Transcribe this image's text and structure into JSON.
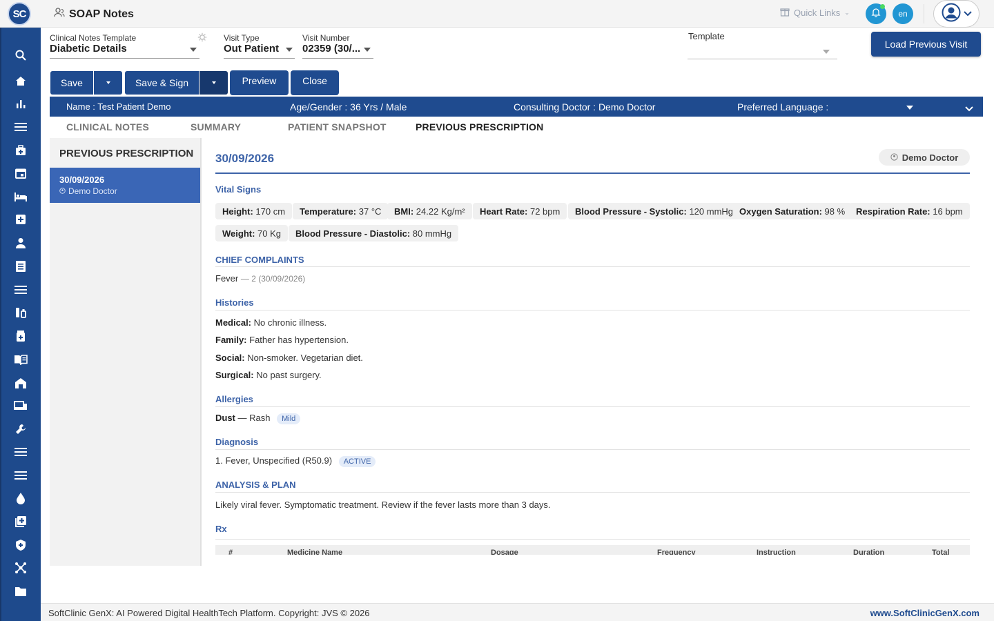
{
  "header": {
    "logo_text": "SC",
    "title": "SOAP Notes",
    "quick_links": "Quick Links",
    "language": "en"
  },
  "form": {
    "clinical_template_label": "Clinical Notes Template",
    "clinical_template_value": "Diabetic Details",
    "visit_type_label": "Visit Type",
    "visit_type_value": "Out Patient",
    "visit_number_label": "Visit Number",
    "visit_number_value": "02359 (30/...",
    "template_label": "Template",
    "template_value": "",
    "load_previous_label": "Load Previous Visit"
  },
  "toolbar": {
    "save": "Save",
    "save_sign": "Save & Sign",
    "preview": "Preview",
    "close": "Close"
  },
  "patient": {
    "name": "Name :  Test Patient Demo",
    "age_gender": "Age/Gender :  36 Yrs / Male",
    "doctor": "Consulting Doctor :  Demo Doctor",
    "language": "Preferred Language :"
  },
  "tabs": [
    "CLINICAL NOTES",
    "SUMMARY",
    "PATIENT SNAPSHOT",
    "PREVIOUS PRESCRIPTION"
  ],
  "left_panel": {
    "heading": "PREVIOUS PRESCRIPTION",
    "items": [
      {
        "date": "30/09/2026",
        "doctor": "Demo Doctor"
      }
    ]
  },
  "detail": {
    "date": "30/09/2026",
    "doctor": "Demo Doctor",
    "vitals_title": "Vital Signs",
    "vitals": [
      {
        "label": "Height:",
        "value": "170 cm"
      },
      {
        "label": "Temperature:",
        "value": "37 °C"
      },
      {
        "label": "BMI:",
        "value": "24.22 Kg/m²"
      },
      {
        "label": "Heart Rate:",
        "value": "72 bpm"
      },
      {
        "label": "Blood Pressure - Systolic:",
        "value": "120 mmHg"
      },
      {
        "label": "Oxygen Saturation:",
        "value": "98 %"
      },
      {
        "label": "Respiration Rate:",
        "value": "16 bpm"
      },
      {
        "label": "Weight:",
        "value": "70 Kg"
      },
      {
        "label": "Blood Pressure - Diastolic:",
        "value": "80 mmHg"
      }
    ],
    "complaints_title": "CHIEF COMPLAINTS",
    "complaint": "Fever",
    "complaint_detail": "— 2 (30/09/2026)",
    "histories_title": "Histories",
    "histories": [
      {
        "label": "Medical:",
        "value": "No chronic illness."
      },
      {
        "label": "Family:",
        "value": "Father has hypertension."
      },
      {
        "label": "Social:",
        "value": "Non-smoker. Vegetarian diet."
      },
      {
        "label": "Surgical:",
        "value": "No past surgery."
      }
    ],
    "allergies_title": "Allergies",
    "allergy_name": "Dust",
    "allergy_reaction": "— Rash",
    "allergy_severity": "Mild",
    "diagnosis_title": "Diagnosis",
    "diagnosis": "1. Fever, Unspecified (R50.9)",
    "diagnosis_status": "ACTIVE",
    "plan_title": "ANALYSIS & PLAN",
    "plan": "Likely viral fever. Symptomatic treatment. Review if the fever lasts more than 3 days.",
    "rx_title": "Rx",
    "rx_columns": [
      "#",
      "Medicine Name",
      "Dosage",
      "Frequency",
      "Instruction",
      "Duration",
      "Total"
    ]
  },
  "footer": {
    "left": "SoftClinic GenX: AI Powered Digital HealthTech Platform. Copyright: JVS © 2026",
    "right": "www.SoftClinicGenX.com"
  }
}
